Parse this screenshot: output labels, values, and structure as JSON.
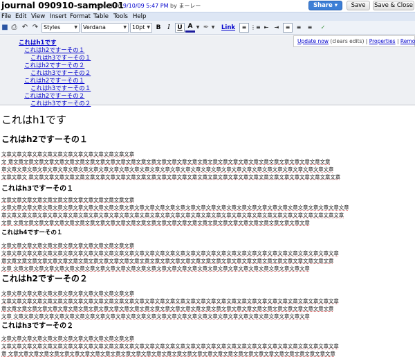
{
  "header": {
    "title": "journal 090910-sample01",
    "saved_prefix": "saved on",
    "saved_time": "9/10/09 5:47 PM",
    "saved_by": "by",
    "saved_user": "まーレー",
    "share_label": "Share ▾",
    "save_label": "Save",
    "save_close_label": "Save & Close"
  },
  "menu": [
    "File",
    "Edit",
    "View",
    "Insert",
    "Format",
    "Table",
    "Tools",
    "Help"
  ],
  "toolbar": {
    "style_select": "Styles",
    "font_select": "Verdana",
    "size_select": "10pt",
    "bold": "B",
    "italic": "I",
    "underline": "U",
    "text_color": "A",
    "link_label": "Link"
  },
  "toc": {
    "items": [
      {
        "text": "これはh1です",
        "level": 1
      },
      {
        "text": "これはh2ですーその１",
        "level": 2
      },
      {
        "text": "これはh3ですーその１",
        "level": 3
      },
      {
        "text": "これはh2ですーその２",
        "level": 2
      },
      {
        "text": "これはh3ですーその２",
        "level": 3
      },
      {
        "text": "これはh2ですーその１",
        "level": 2
      },
      {
        "text": "これはh3ですーその１",
        "level": 3
      },
      {
        "text": "これはh2ですーその２",
        "level": 2
      },
      {
        "text": "これはh3ですーその２",
        "level": 3
      }
    ],
    "popup": {
      "update_now": "Update now",
      "clears_edits": "(clears edits)",
      "sep1": "|",
      "properties": "Properties",
      "sep2": "|",
      "remove": "Remove"
    }
  },
  "document": {
    "h1": "これはh1です",
    "sec1_h2": "これはh2ですーその１",
    "sec1_p": [
      "文章文章文章文章文章文章文章文章文章文章文章文章文章",
      "文 章文章文章文章文章文章文章文章文章文章文章文章文章文章文章文章文章文章文章文章文章文章文章文章文章文章文章文章文章文章文章文章",
      "章文章文章文章文章文章文章文章文章文章文章文章文章文章文章文章文章文章文章文章文章文章文章文章文章文章文章文章文章文章文章文章文章",
      "文章文章文 章文章文章文章文章文章文章文章文章文章文章文章文章文章文章文章文章文章文章文章文章文章文章文章文章文章文章文章文章文章文章"
    ],
    "sec2_h3": "これはh3ですーその１",
    "sec2_p": [
      "文章文章文章文章文章文章文章文章文章文章文章文章文章",
      "文章文章文章文章文章文章文章文章文章文章文章文章文章文章文章文章文章文章文章文章文章文章文章文章文章文章文章文章文章文章文章文章文章文章",
      "章文章文章文章文章文章文章文章文章文章文章文章文章文章文章文章文章文章文章文章文章文章文章文章文章文章文章文章文章文章文章文章文章文章",
      "文章 文章文章文章文章文章文章文章文章文章文章文章文章文章文章文章文章文章文章文章文章文章文章文章文章文章文章文章文章文章"
    ],
    "sec3_h4": "これはh4ですーその１",
    "sec3_p": [
      "文章文章文章文章文章文章文章文章文章文章文章文章文章",
      "文章文章文章文章文章文章文章文章文章文章文章文章文章文章文章文章文章文章文章文章文章文章文章文章文章文章文章文章文章文章文章文章文章",
      "章文章文章文章文章文章文章文章文章文章文章文章文章文章文章文章文章文章文章文章文章文章文章文章文章文章文章文章文章文章文章文章文章",
      "文章 文章文章文章文章文章文章文章文章文章文章文章文章文章文章文章文章文章文章文章文章文章文章文章文章文章文章文章文章文章"
    ],
    "sec4_h2": "これはh2ですーその２",
    "sec4_p": [
      "文章文章文章文章文章文章文章文章文章文章文章文章文章",
      "文章文章文章文章文章文章文章文章文章文章文章文章文章文章文章文章文章文章文章文章文章文章文章文章文章文章文章文章文章文章文章文章文章",
      "章文章文章文章文章文章文章文章文章文章文章文章文章文章文章文章文章文章文章文章文章文章文章文章文章文章文章文章文章文章文章文章文章",
      "文章 文章文章文章文章文章文章文章文章文章文章文章文章文章文章文章文章文章文章文章文章文章文章文章文章文章文章文章文章文章"
    ],
    "sec5_h3": "これはh3ですーその２",
    "sec5_p": [
      "文章文章文章文章文章文章文章文章文章文章文章文章文章",
      "文章文章文章文章文章文章文章文章文章文章文章文章文章文章文章文章文章文章文章文章文章文章文章文章文章文章文章文章文章文章文章文章文章",
      "章 文章文章文章文章文章文章文章文章文章文章文章文章文章文章文章文章文章文章文章文章文章文章文章文章文章文章文章文章文章文章文章文章"
    ]
  }
}
